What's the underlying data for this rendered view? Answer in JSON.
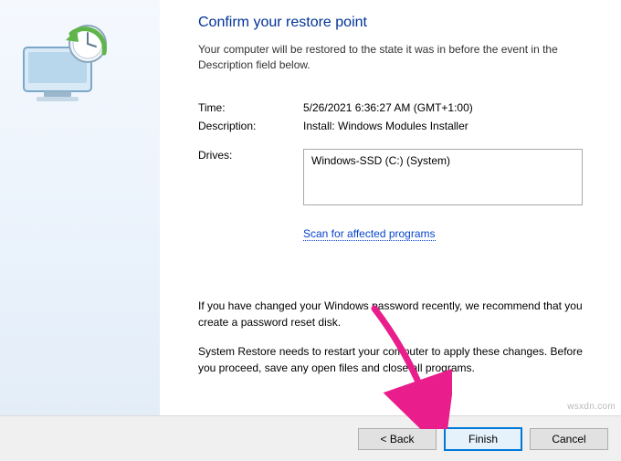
{
  "heading": "Confirm your restore point",
  "intro": "Your computer will be restored to the state it was in before the event in the Description field below.",
  "labels": {
    "time": "Time:",
    "description": "Description:",
    "drives": "Drives:"
  },
  "values": {
    "time": "5/26/2021 6:36:27 AM (GMT+1:00)",
    "description": "Install: Windows Modules Installer",
    "drives": "Windows-SSD (C:) (System)"
  },
  "scan_link": "Scan for affected programs",
  "notice1": "If you have changed your Windows password recently, we recommend that you create a password reset disk.",
  "notice2": "System Restore needs to restart your computer to apply these changes. Before you proceed, save any open files and close all programs.",
  "buttons": {
    "back": "< Back",
    "finish": "Finish",
    "cancel": "Cancel"
  },
  "watermark": "wsxdn.com"
}
